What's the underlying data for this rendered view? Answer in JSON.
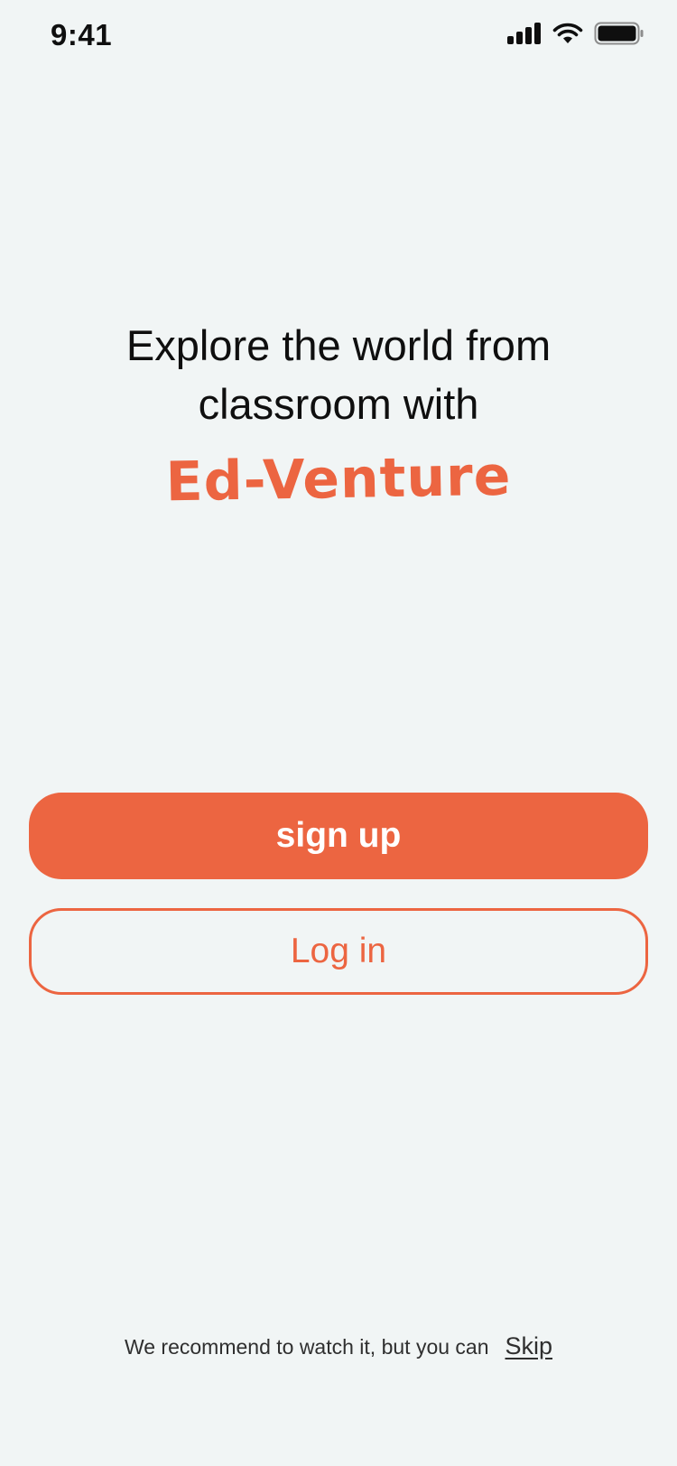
{
  "status_bar": {
    "time": "9:41",
    "icons": [
      "signal-icon",
      "wifi-icon",
      "battery-icon"
    ]
  },
  "headline": {
    "line1": "Explore the world from",
    "line2": "classroom with",
    "brand": "Ed-Venture"
  },
  "buttons": {
    "signup_label": "sign up",
    "login_label": "Log in"
  },
  "footer": {
    "text": "We recommend to watch it, but you can",
    "skip_label": "Skip"
  },
  "colors": {
    "accent": "#ec6541",
    "background": "#f1f5f5",
    "text": "#0f0f0f"
  }
}
